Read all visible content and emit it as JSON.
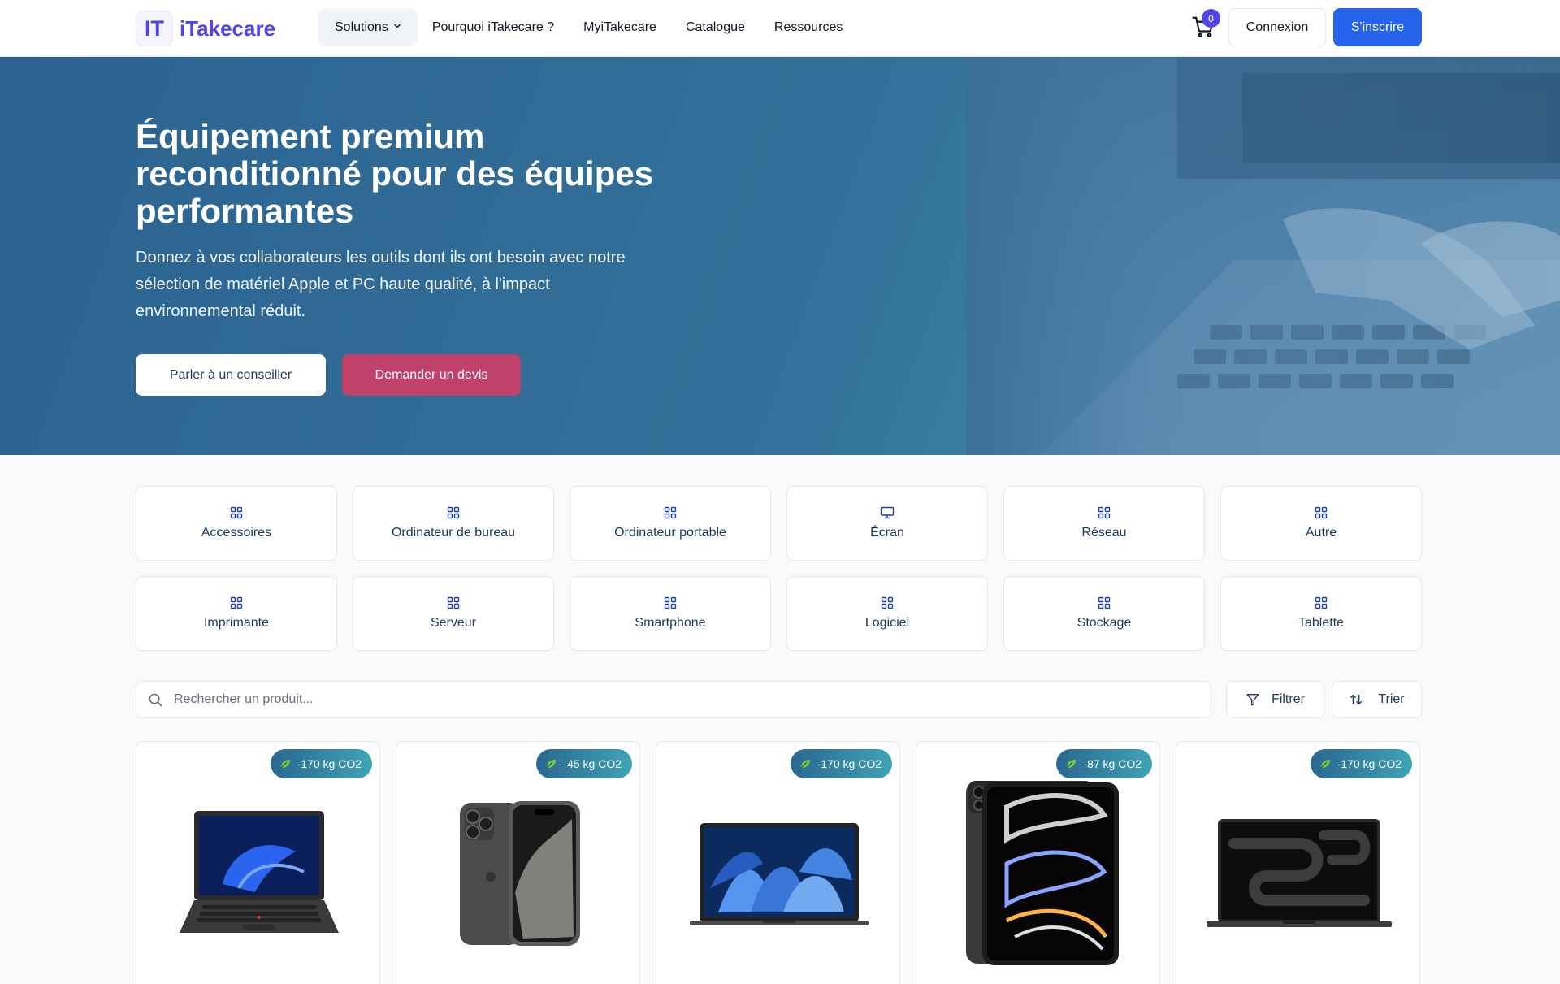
{
  "header": {
    "logo_mark": "IT",
    "logo_text": "iTakecare",
    "nav": [
      {
        "label": "Solutions"
      },
      {
        "label": "Pourquoi iTakecare ?"
      },
      {
        "label": "MyiTakecare"
      },
      {
        "label": "Catalogue"
      },
      {
        "label": "Ressources"
      }
    ],
    "cart_count": "0",
    "login_label": "Connexion",
    "signup_label": "S'inscrire"
  },
  "hero": {
    "title": "Équipement premium reconditionné pour des équipes performantes",
    "subtitle": "Donnez à vos collaborateurs les outils dont ils ont besoin avec notre sélection de matériel Apple et PC haute qualité, à l'impact environnemental réduit.",
    "cta_primary": "Parler à un conseiller",
    "cta_secondary": "Demander un devis"
  },
  "categories": [
    {
      "label": "Accessoires",
      "icon": "grid-icon"
    },
    {
      "label": "Ordinateur de bureau",
      "icon": "grid-icon"
    },
    {
      "label": "Ordinateur portable",
      "icon": "grid-icon"
    },
    {
      "label": "Écran",
      "icon": "monitor-icon"
    },
    {
      "label": "Réseau",
      "icon": "grid-icon"
    },
    {
      "label": "Autre",
      "icon": "grid-icon"
    },
    {
      "label": "Imprimante",
      "icon": "grid-icon"
    },
    {
      "label": "Serveur",
      "icon": "grid-icon"
    },
    {
      "label": "Smartphone",
      "icon": "grid-icon"
    },
    {
      "label": "Logiciel",
      "icon": "grid-icon"
    },
    {
      "label": "Stockage",
      "icon": "grid-icon"
    },
    {
      "label": "Tablette",
      "icon": "grid-icon"
    }
  ],
  "search": {
    "placeholder": "Rechercher un produit...",
    "filter_label": "Filtrer",
    "sort_label": "Trier"
  },
  "products": [
    {
      "co2": "-170 kg CO2",
      "kind": "pc-laptop"
    },
    {
      "co2": "-45 kg CO2",
      "kind": "iphone"
    },
    {
      "co2": "-170 kg CO2",
      "kind": "macbook-air"
    },
    {
      "co2": "-87 kg CO2",
      "kind": "ipad"
    },
    {
      "co2": "-170 kg CO2",
      "kind": "macbook-pro"
    }
  ],
  "colors": {
    "brand": "#4f46e5",
    "primary_button": "#2563eb",
    "quote_button": "#c0426a",
    "hero_gradient_start": "#2c6290",
    "hero_gradient_end": "#4ba2b4",
    "badge_gradient_start": "#2a6790",
    "badge_gradient_end": "#3fa3b5"
  }
}
